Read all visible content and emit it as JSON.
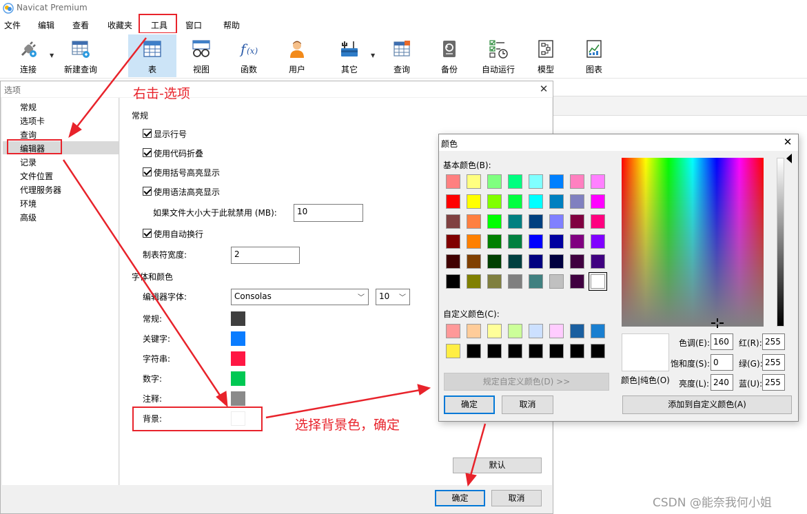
{
  "app": {
    "title": "Navicat Premium",
    "logo": "navicat-logo"
  },
  "menu": {
    "items": [
      "文件",
      "编辑",
      "查看",
      "收藏夹",
      "工具",
      "窗口",
      "帮助"
    ],
    "highlighted": "工具"
  },
  "toolbar": {
    "buttons": [
      {
        "label": "连接",
        "icon": "plug-icon"
      },
      {
        "label": "新建查询",
        "icon": "new-query-icon"
      },
      {
        "label": "表",
        "icon": "table-icon"
      },
      {
        "label": "视图",
        "icon": "view-icon"
      },
      {
        "label": "函数",
        "icon": "function-icon"
      },
      {
        "label": "用户",
        "icon": "user-icon"
      },
      {
        "label": "其它",
        "icon": "tools-icon"
      },
      {
        "label": "查询",
        "icon": "query-icon"
      },
      {
        "label": "备份",
        "icon": "backup-icon"
      },
      {
        "label": "自动运行",
        "icon": "schedule-icon"
      },
      {
        "label": "模型",
        "icon": "model-icon"
      },
      {
        "label": "图表",
        "icon": "chart-icon"
      }
    ]
  },
  "options": {
    "title": "选项",
    "nav": [
      "常规",
      "选项卡",
      "查询",
      "编辑器",
      "记录",
      "文件位置",
      "代理服务器",
      "环境",
      "高级"
    ],
    "selected_nav": "编辑器",
    "general_heading": "常规",
    "checkboxes": [
      {
        "label": "显示行号",
        "checked": true
      },
      {
        "label": "使用代码折叠",
        "checked": true
      },
      {
        "label": "使用括号高亮显示",
        "checked": true
      },
      {
        "label": "使用语法高亮显示",
        "checked": true
      },
      {
        "label": "使用自动换行",
        "checked": true
      }
    ],
    "disable_size_label": "如果文件大小大于此就禁用 (MB):",
    "disable_size_value": "10",
    "tab_width_label": "制表符宽度:",
    "tab_width_value": "2",
    "font_color_heading": "字体和颜色",
    "editor_font_label": "编辑器字体:",
    "editor_font_value": "Consolas",
    "editor_font_size": "10",
    "colors": [
      {
        "label": "常规:",
        "color": "#3f3f3f"
      },
      {
        "label": "关键字:",
        "color": "#0a7cff"
      },
      {
        "label": "字符串:",
        "color": "#ff1744"
      },
      {
        "label": "数字:",
        "color": "#00c853"
      },
      {
        "label": "注释:",
        "color": "#8a8a8a"
      },
      {
        "label": "背景:",
        "color": "#ffffff"
      }
    ],
    "default_button": "默认",
    "ok_button": "确定",
    "cancel_button": "取消"
  },
  "color_dialog": {
    "title": "颜色",
    "basic_label": "基本颜色(B):",
    "basic_colors": [
      [
        "#ff8080",
        "#ffff80",
        "#80ff80",
        "#00ff80",
        "#80ffff",
        "#0080ff",
        "#ff80c0",
        "#ff80ff"
      ],
      [
        "#ff0000",
        "#ffff00",
        "#80ff00",
        "#00ff40",
        "#00ffff",
        "#0080c0",
        "#8080c0",
        "#ff00ff"
      ],
      [
        "#804040",
        "#ff8040",
        "#00ff00",
        "#008080",
        "#004080",
        "#8080ff",
        "#800040",
        "#ff0080"
      ],
      [
        "#800000",
        "#ff8000",
        "#008000",
        "#008040",
        "#0000ff",
        "#0000a0",
        "#800080",
        "#8000ff"
      ],
      [
        "#400000",
        "#804000",
        "#004000",
        "#004040",
        "#000080",
        "#000040",
        "#400040",
        "#400080"
      ],
      [
        "#000000",
        "#808000",
        "#808040",
        "#808080",
        "#408080",
        "#c0c0c0",
        "#400040",
        "#ffffff"
      ]
    ],
    "custom_label": "自定义颜色(C):",
    "custom_colors": [
      [
        "#ff9999",
        "#ffcc99",
        "#ffff99",
        "#ccff99",
        "#cce0ff",
        "#ffccff",
        "#1a5fa0",
        "#1a7fd0"
      ],
      [
        "#ffee44",
        "#000000",
        "#000000",
        "#000000",
        "#000000",
        "#000000",
        "#000000",
        "#000000"
      ]
    ],
    "define_custom_button": "规定自定义颜色(D) >>",
    "ok_button": "确定",
    "cancel_button": "取消",
    "preview_label": "颜色|纯色(O)",
    "hue_label": "色调(E):",
    "hue": "160",
    "sat_label": "饱和度(S):",
    "sat": "0",
    "lum_label": "亮度(L):",
    "lum": "240",
    "red_label": "红(R):",
    "red": "255",
    "green_label": "绿(G):",
    "green": "255",
    "blue_label": "蓝(U):",
    "blue": "255",
    "add_custom_button": "添加到自定义颜色(A)"
  },
  "annotations": {
    "right_click_note": "右击-选项",
    "select_bg_note": "选择背景色，确定",
    "highlight_color": "#e8232b"
  },
  "watermark": "CSDN @能奈我何小姐"
}
